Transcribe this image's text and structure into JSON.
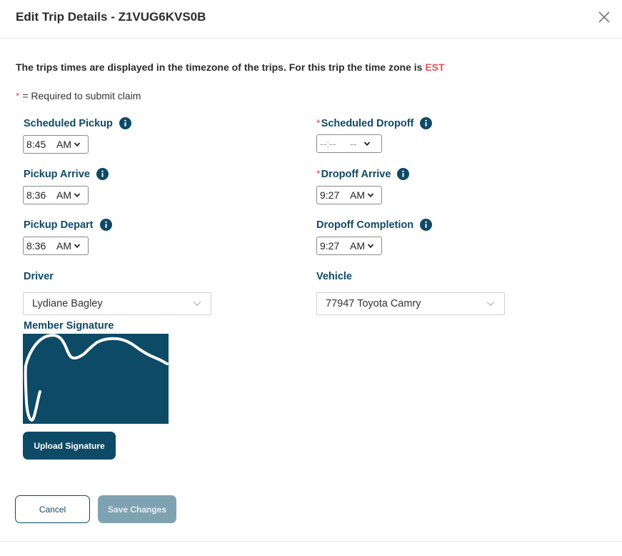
{
  "dialog": {
    "title": "Edit Trip Details - Z1VUG6KVS0B"
  },
  "timezone_note": {
    "text": "The trips times are displayed in the timezone of the trips. For this trip the time zone is ",
    "zone": "EST",
    "zone_color": "#e05555"
  },
  "required_note": {
    "star": "*",
    "text": " = Required to submit claim"
  },
  "fields": {
    "scheduled_pickup": {
      "label": "Scheduled Pickup",
      "time": "8:45",
      "ampm": "AM"
    },
    "scheduled_dropoff": {
      "star": "*",
      "label": "Scheduled Dropoff",
      "time": "--:--",
      "ampm": "--"
    },
    "pickup_arrive": {
      "label": "Pickup Arrive",
      "time": "8:36",
      "ampm": "AM"
    },
    "dropoff_arrive": {
      "star": "*",
      "label": "Dropoff Arrive",
      "time": "9:27",
      "ampm": "AM"
    },
    "pickup_depart": {
      "label": "Pickup Depart",
      "time": "8:36",
      "ampm": "AM"
    },
    "dropoff_completion": {
      "label": "Dropoff Completion",
      "time": "9:27",
      "ampm": "AM"
    }
  },
  "driver": {
    "label": "Driver",
    "value": "Lydiane Bagley"
  },
  "vehicle": {
    "label": "Vehicle",
    "value": "77947 Toyota Camry"
  },
  "signature": {
    "label": "Member Signature"
  },
  "buttons": {
    "upload": "Upload Signature",
    "cancel": "Cancel",
    "save": "Save Changes"
  },
  "colors": {
    "brand": "#0d4a66",
    "required": "#e05555",
    "save_disabled": "#7fa2b2"
  },
  "icons": [
    "close-icon",
    "info-icon",
    "chevron-down-icon"
  ]
}
